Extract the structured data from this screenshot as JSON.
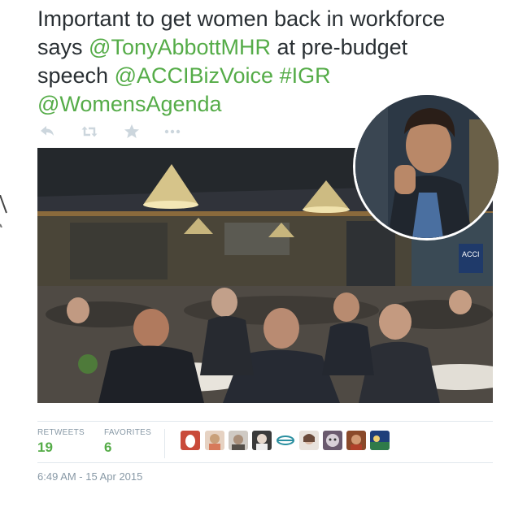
{
  "tweet": {
    "line1": "Important to get women back in workforce",
    "says": "says ",
    "mention1": "@TonyAbbottMHR",
    "after_mention1": " at pre-budget",
    "speech": "speech ",
    "mention2": "@ACCIBizVoice",
    "space": " ",
    "hashtag": "#IGR",
    "mention3": "@WomensAgenda"
  },
  "actions": [
    {
      "name": "reply-icon"
    },
    {
      "name": "retweet-icon"
    },
    {
      "name": "favorite-icon"
    },
    {
      "name": "more-icon"
    }
  ],
  "stats": {
    "retweets_label": "RETWEETS",
    "retweets_value": "19",
    "favorites_label": "FAVORITES",
    "favorites_value": "6"
  },
  "timestamp": "6:49 AM - 15 Apr 2015",
  "colors": {
    "text": "#292f33",
    "link": "#55ac48",
    "muted": "#8899a6",
    "divider": "#e1e8ed"
  },
  "favoriter_avatars": [
    {
      "name": "avatar-1"
    },
    {
      "name": "avatar-2"
    },
    {
      "name": "avatar-3"
    },
    {
      "name": "avatar-4"
    },
    {
      "name": "avatar-5"
    },
    {
      "name": "avatar-6"
    },
    {
      "name": "avatar-7"
    },
    {
      "name": "avatar-8"
    },
    {
      "name": "avatar-9"
    }
  ],
  "photo_sign": "ACCI"
}
